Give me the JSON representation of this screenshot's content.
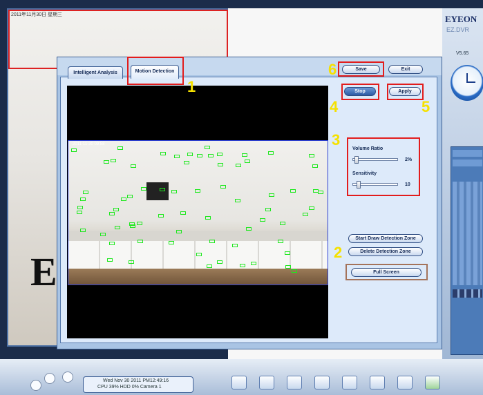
{
  "background": {
    "cam_overlay_text": "2011年11月30日 星期三",
    "big_logo_letter": "E"
  },
  "right_dock": {
    "brand": "EYEON",
    "brand_sub": "EZ.DVR",
    "version": "V5.65"
  },
  "dialog": {
    "tabs": [
      {
        "label": "Intelligent Analysis"
      },
      {
        "label": "Motion Detection"
      }
    ],
    "save_label": "Save",
    "exit_label": "Exit",
    "stop_label": "Stop",
    "apply_label": "Apply",
    "volume_ratio": {
      "label": "Volume Ratio",
      "value": "2%",
      "level": 0.05
    },
    "sensitivity": {
      "label": "Sensitivity",
      "value": "10",
      "level": 0.1
    },
    "start_draw_label": "Start Draw Detection Zone",
    "delete_zone_label": "Delete Detection Zone",
    "full_screen_label": "Full Screen",
    "video_timestamp": "2011-11-30 09:58"
  },
  "annotations": [
    "1",
    "2",
    "3",
    "4",
    "5",
    "6"
  ],
  "taskbar": {
    "status_line1": "Wed Nov 30 2011   PM12:49:16",
    "status_line2": "CPU 39%   HDD 0%     Camera 1"
  },
  "colors": {
    "annotation_red": "#e21c1c",
    "annotation_number_yellow": "#f5e100",
    "motion_marker_green": "#1ee81e",
    "detection_zone_blue": "#2b3fd4"
  }
}
